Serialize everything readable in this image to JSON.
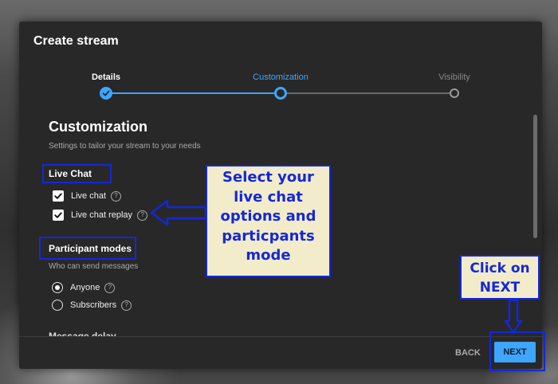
{
  "dialog": {
    "title": "Create stream"
  },
  "stepper": {
    "steps": [
      {
        "label": "Details",
        "state": "done"
      },
      {
        "label": "Customization",
        "state": "active"
      },
      {
        "label": "Visibility",
        "state": "pending"
      }
    ]
  },
  "customization": {
    "heading": "Customization",
    "description": "Settings to tailor your stream to your needs",
    "live_chat": {
      "label": "Live Chat",
      "options": [
        {
          "label": "Live chat",
          "checked": true
        },
        {
          "label": "Live chat replay",
          "checked": true
        }
      ]
    },
    "participant_modes": {
      "label": "Participant modes",
      "description": "Who can send messages",
      "options": [
        {
          "label": "Anyone",
          "selected": true
        },
        {
          "label": "Subscribers",
          "selected": false
        }
      ]
    },
    "next_section_label": "Message delay"
  },
  "footer": {
    "back_label": "BACK",
    "next_label": "NEXT"
  },
  "annotations": {
    "callout_options_lines": [
      "Select your",
      "live chat",
      "options and",
      "particpants",
      "mode"
    ],
    "callout_next_lines": [
      "Click on",
      "NEXT"
    ]
  },
  "colors": {
    "accent": "#3ea6ff",
    "annotation": "#1428d8",
    "callout_bg": "#f2eccb",
    "dialog_bg": "#282828"
  },
  "icons": {
    "done_step": "check-icon",
    "help": "help-icon",
    "checkbox": "checkbox-checked-icon",
    "arrow_left": "arrow-left-icon",
    "arrow_down": "arrow-down-icon"
  }
}
